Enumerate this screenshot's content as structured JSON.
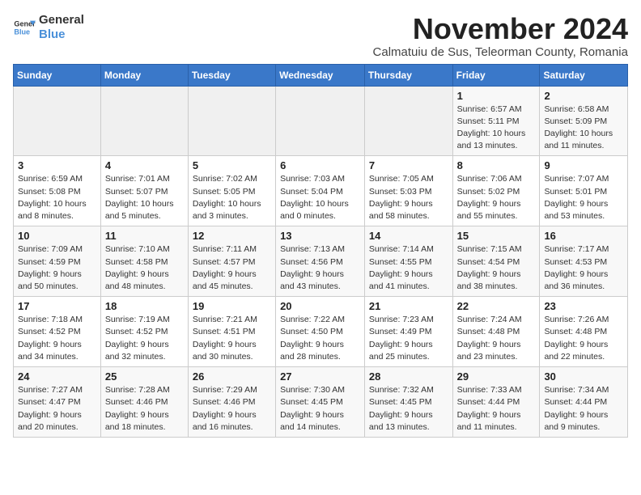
{
  "logo": {
    "line1": "General",
    "line2": "Blue"
  },
  "title": "November 2024",
  "subtitle": "Calmatuiu de Sus, Teleorman County, Romania",
  "days_of_week": [
    "Sunday",
    "Monday",
    "Tuesday",
    "Wednesday",
    "Thursday",
    "Friday",
    "Saturday"
  ],
  "weeks": [
    [
      {
        "day": "",
        "info": ""
      },
      {
        "day": "",
        "info": ""
      },
      {
        "day": "",
        "info": ""
      },
      {
        "day": "",
        "info": ""
      },
      {
        "day": "",
        "info": ""
      },
      {
        "day": "1",
        "info": "Sunrise: 6:57 AM\nSunset: 5:11 PM\nDaylight: 10 hours and 13 minutes."
      },
      {
        "day": "2",
        "info": "Sunrise: 6:58 AM\nSunset: 5:09 PM\nDaylight: 10 hours and 11 minutes."
      }
    ],
    [
      {
        "day": "3",
        "info": "Sunrise: 6:59 AM\nSunset: 5:08 PM\nDaylight: 10 hours and 8 minutes."
      },
      {
        "day": "4",
        "info": "Sunrise: 7:01 AM\nSunset: 5:07 PM\nDaylight: 10 hours and 5 minutes."
      },
      {
        "day": "5",
        "info": "Sunrise: 7:02 AM\nSunset: 5:05 PM\nDaylight: 10 hours and 3 minutes."
      },
      {
        "day": "6",
        "info": "Sunrise: 7:03 AM\nSunset: 5:04 PM\nDaylight: 10 hours and 0 minutes."
      },
      {
        "day": "7",
        "info": "Sunrise: 7:05 AM\nSunset: 5:03 PM\nDaylight: 9 hours and 58 minutes."
      },
      {
        "day": "8",
        "info": "Sunrise: 7:06 AM\nSunset: 5:02 PM\nDaylight: 9 hours and 55 minutes."
      },
      {
        "day": "9",
        "info": "Sunrise: 7:07 AM\nSunset: 5:01 PM\nDaylight: 9 hours and 53 minutes."
      }
    ],
    [
      {
        "day": "10",
        "info": "Sunrise: 7:09 AM\nSunset: 4:59 PM\nDaylight: 9 hours and 50 minutes."
      },
      {
        "day": "11",
        "info": "Sunrise: 7:10 AM\nSunset: 4:58 PM\nDaylight: 9 hours and 48 minutes."
      },
      {
        "day": "12",
        "info": "Sunrise: 7:11 AM\nSunset: 4:57 PM\nDaylight: 9 hours and 45 minutes."
      },
      {
        "day": "13",
        "info": "Sunrise: 7:13 AM\nSunset: 4:56 PM\nDaylight: 9 hours and 43 minutes."
      },
      {
        "day": "14",
        "info": "Sunrise: 7:14 AM\nSunset: 4:55 PM\nDaylight: 9 hours and 41 minutes."
      },
      {
        "day": "15",
        "info": "Sunrise: 7:15 AM\nSunset: 4:54 PM\nDaylight: 9 hours and 38 minutes."
      },
      {
        "day": "16",
        "info": "Sunrise: 7:17 AM\nSunset: 4:53 PM\nDaylight: 9 hours and 36 minutes."
      }
    ],
    [
      {
        "day": "17",
        "info": "Sunrise: 7:18 AM\nSunset: 4:52 PM\nDaylight: 9 hours and 34 minutes."
      },
      {
        "day": "18",
        "info": "Sunrise: 7:19 AM\nSunset: 4:52 PM\nDaylight: 9 hours and 32 minutes."
      },
      {
        "day": "19",
        "info": "Sunrise: 7:21 AM\nSunset: 4:51 PM\nDaylight: 9 hours and 30 minutes."
      },
      {
        "day": "20",
        "info": "Sunrise: 7:22 AM\nSunset: 4:50 PM\nDaylight: 9 hours and 28 minutes."
      },
      {
        "day": "21",
        "info": "Sunrise: 7:23 AM\nSunset: 4:49 PM\nDaylight: 9 hours and 25 minutes."
      },
      {
        "day": "22",
        "info": "Sunrise: 7:24 AM\nSunset: 4:48 PM\nDaylight: 9 hours and 23 minutes."
      },
      {
        "day": "23",
        "info": "Sunrise: 7:26 AM\nSunset: 4:48 PM\nDaylight: 9 hours and 22 minutes."
      }
    ],
    [
      {
        "day": "24",
        "info": "Sunrise: 7:27 AM\nSunset: 4:47 PM\nDaylight: 9 hours and 20 minutes."
      },
      {
        "day": "25",
        "info": "Sunrise: 7:28 AM\nSunset: 4:46 PM\nDaylight: 9 hours and 18 minutes."
      },
      {
        "day": "26",
        "info": "Sunrise: 7:29 AM\nSunset: 4:46 PM\nDaylight: 9 hours and 16 minutes."
      },
      {
        "day": "27",
        "info": "Sunrise: 7:30 AM\nSunset: 4:45 PM\nDaylight: 9 hours and 14 minutes."
      },
      {
        "day": "28",
        "info": "Sunrise: 7:32 AM\nSunset: 4:45 PM\nDaylight: 9 hours and 13 minutes."
      },
      {
        "day": "29",
        "info": "Sunrise: 7:33 AM\nSunset: 4:44 PM\nDaylight: 9 hours and 11 minutes."
      },
      {
        "day": "30",
        "info": "Sunrise: 7:34 AM\nSunset: 4:44 PM\nDaylight: 9 hours and 9 minutes."
      }
    ]
  ]
}
